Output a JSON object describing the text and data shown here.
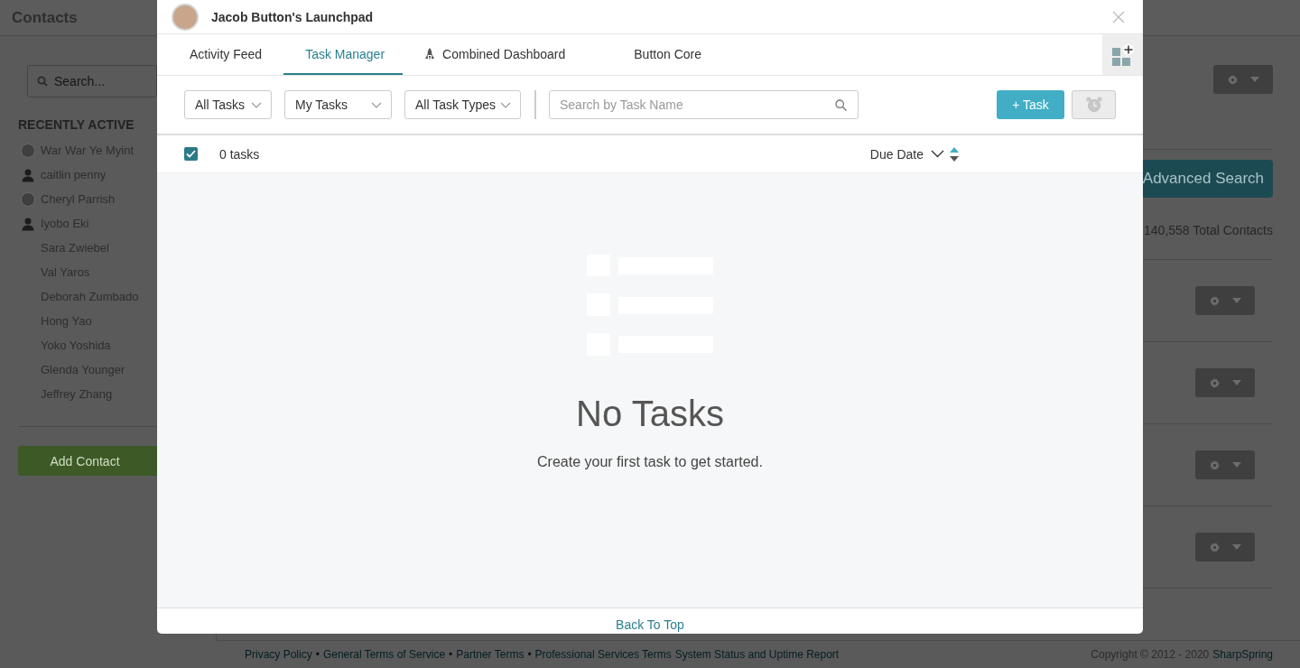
{
  "app": {
    "title": "Contacts",
    "search": {
      "placeholder": "Search..."
    },
    "recent_heading": "RECENTLY ACTIVE",
    "recent": [
      {
        "name": "War War Ye Myint",
        "kind": "photo"
      },
      {
        "name": "caitlin penny",
        "kind": "silhouette"
      },
      {
        "name": "Cheryl Parrish",
        "kind": "photo"
      },
      {
        "name": "Iyobo Eki",
        "kind": "silhouette"
      },
      {
        "name": "Sara Zwiebel",
        "kind": "plain"
      },
      {
        "name": "Val Yaros",
        "kind": "plain"
      },
      {
        "name": "Deborah Zumbado",
        "kind": "plain"
      },
      {
        "name": "Hong Yao",
        "kind": "plain"
      },
      {
        "name": "Yoko Yoshida",
        "kind": "plain"
      },
      {
        "name": "Glenda Younger",
        "kind": "plain"
      },
      {
        "name": "Jeffrey Zhang",
        "kind": "plain"
      }
    ],
    "add_button": "Add Contact",
    "advanced_search": "Advanced Search",
    "total": "140,558 Total Contacts",
    "footer": {
      "links": [
        "Privacy Policy",
        "General Terms of Service",
        "Partner Terms",
        "Professional Services Terms",
        "System Status and Uptime Report"
      ],
      "separator": "•",
      "copyright": "Copyright © 2012 - 2020",
      "brand": "SharpSpring"
    }
  },
  "launchpad": {
    "title": "Jacob Button's Launchpad",
    "tabs": [
      {
        "label": "Activity Feed",
        "selected": false,
        "kind": "plain"
      },
      {
        "label": "Task Manager",
        "selected": true,
        "kind": "plain"
      },
      {
        "label": "Combined Dashboard",
        "selected": false,
        "kind": "rocket"
      },
      {
        "label": "Button Core",
        "selected": false,
        "kind": "plain"
      }
    ],
    "filters": [
      {
        "label": "All Tasks"
      },
      {
        "label": "My Tasks"
      },
      {
        "label": "All Task Types"
      }
    ],
    "search": {
      "placeholder": "Search by Task Name"
    },
    "add_task": "+ Task",
    "select_all": {
      "checked": true
    },
    "count": "0 tasks",
    "sort": "Due Date",
    "empty": {
      "title": "No Tasks",
      "message": "Create your first task to get started."
    },
    "back_to_top": "Back To Top"
  }
}
